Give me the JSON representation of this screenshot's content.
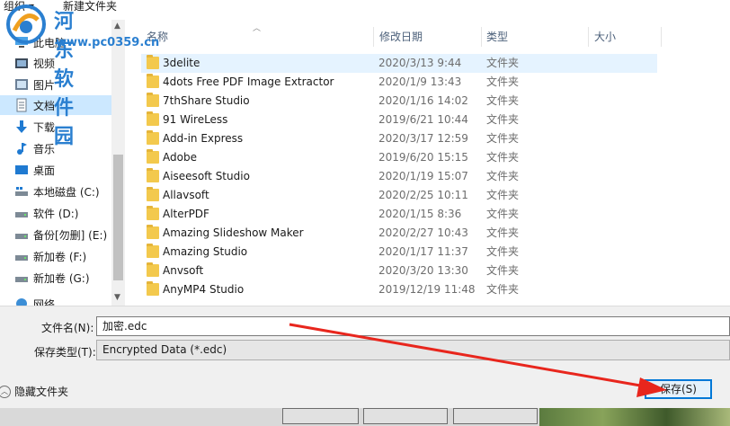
{
  "toolbar": {
    "organize": "组织 ▾",
    "new_folder": "新建文件夹"
  },
  "watermark": {
    "title": "河东软件园",
    "url": "www.pc0359.cn"
  },
  "nav": {
    "items": [
      {
        "label": "此电脑",
        "icon": "computer-icon"
      },
      {
        "label": "视频",
        "icon": "video-icon"
      },
      {
        "label": "图片",
        "icon": "pictures-icon"
      },
      {
        "label": "文档",
        "icon": "documents-icon",
        "selected": true
      },
      {
        "label": "下载",
        "icon": "download-icon"
      },
      {
        "label": "音乐",
        "icon": "music-icon"
      },
      {
        "label": "桌面",
        "icon": "desktop-icon"
      },
      {
        "label": "本地磁盘 (C:)",
        "icon": "drive-c-icon"
      },
      {
        "label": "软件 (D:)",
        "icon": "drive-icon"
      },
      {
        "label": "备份[勿删] (E:)",
        "icon": "drive-icon"
      },
      {
        "label": "新加卷 (F:)",
        "icon": "drive-icon"
      },
      {
        "label": "新加卷 (G:)",
        "icon": "drive-icon"
      },
      {
        "label": "网络",
        "icon": "network-icon"
      }
    ]
  },
  "columns": {
    "name": "名称",
    "date": "修改日期",
    "type": "类型",
    "size": "大小"
  },
  "files": [
    {
      "name": "3delite",
      "date": "2020/3/13 9:44",
      "type": "文件夹"
    },
    {
      "name": "4dots Free PDF Image Extractor",
      "date": "2020/1/9 13:43",
      "type": "文件夹"
    },
    {
      "name": "7thShare Studio",
      "date": "2020/1/16 14:02",
      "type": "文件夹"
    },
    {
      "name": "91 WireLess",
      "date": "2019/6/21 10:44",
      "type": "文件夹"
    },
    {
      "name": "Add-in Express",
      "date": "2020/3/17 12:59",
      "type": "文件夹"
    },
    {
      "name": "Adobe",
      "date": "2019/6/20 15:15",
      "type": "文件夹"
    },
    {
      "name": "Aiseesoft Studio",
      "date": "2020/1/19 15:07",
      "type": "文件夹"
    },
    {
      "name": "Allavsoft",
      "date": "2020/2/25 10:11",
      "type": "文件夹"
    },
    {
      "name": "AlterPDF",
      "date": "2020/1/15 8:36",
      "type": "文件夹"
    },
    {
      "name": "Amazing Slideshow Maker",
      "date": "2020/2/27 10:43",
      "type": "文件夹"
    },
    {
      "name": "Amazing Studio",
      "date": "2020/1/17 11:37",
      "type": "文件夹"
    },
    {
      "name": "Anvsoft",
      "date": "2020/3/20 13:30",
      "type": "文件夹"
    },
    {
      "name": "AnyMP4 Studio",
      "date": "2019/12/19 11:48",
      "type": "文件夹"
    }
  ],
  "form": {
    "filename_label": "文件名(N):",
    "filename_value": "加密.edc",
    "filetype_label": "保存类型(T):",
    "filetype_value": "Encrypted Data (*.edc)",
    "hide_folders": "隐藏文件夹",
    "save_button": "保存(S)"
  },
  "colors": {
    "accent": "#0078d7",
    "selection": "#cce8ff",
    "annotation_arrow": "#e8261d"
  }
}
